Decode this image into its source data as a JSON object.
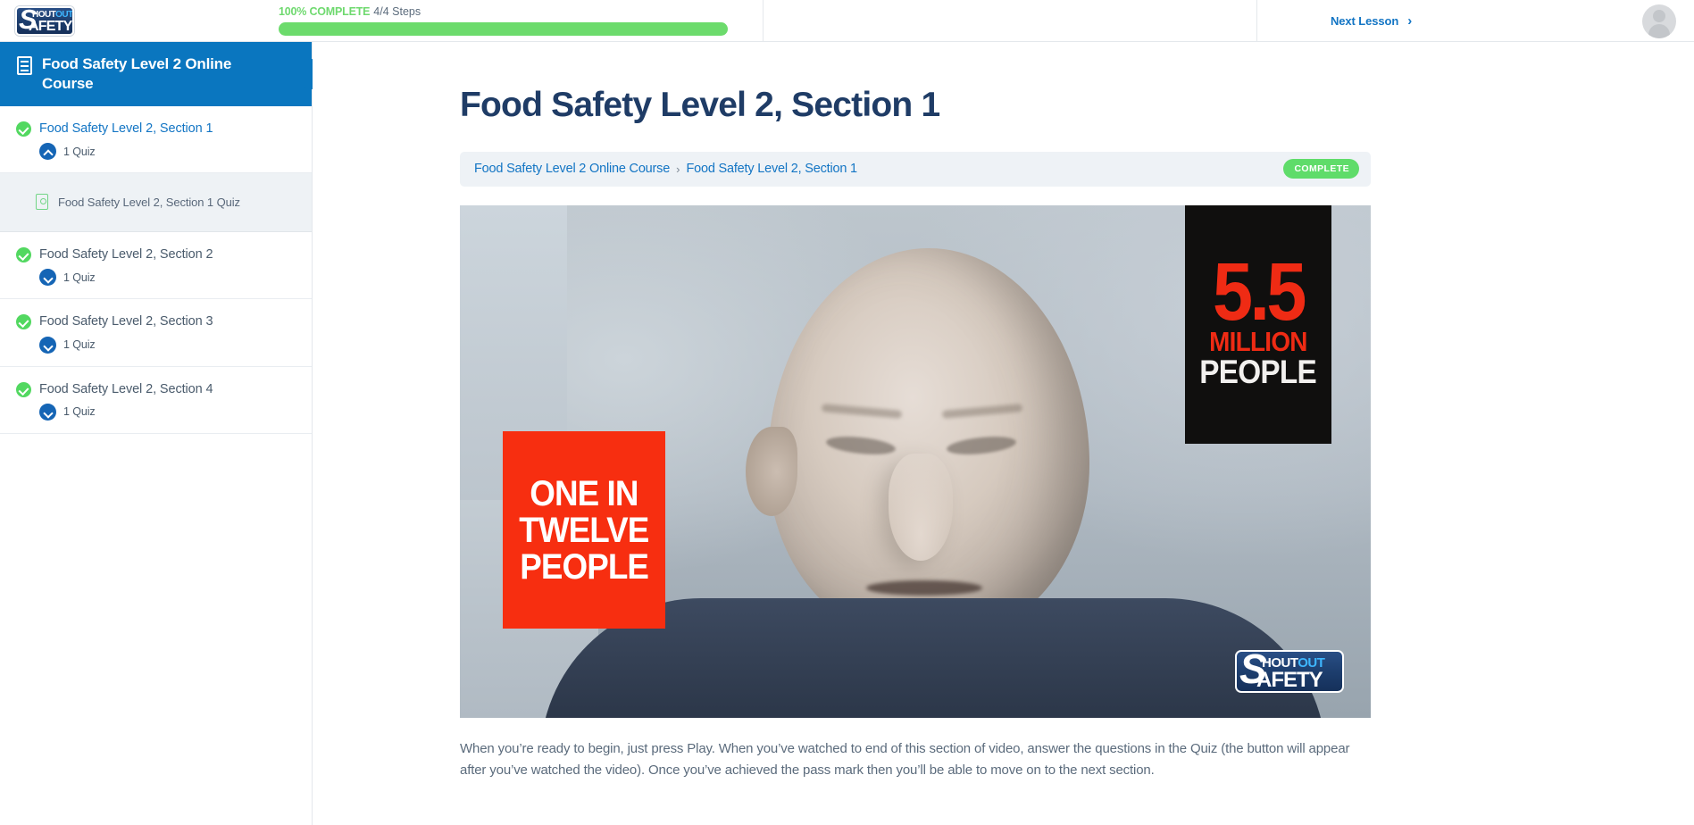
{
  "topbar": {
    "logo": {
      "name": "shout-out-safety-logo",
      "line1_a": "HOUT",
      "line1_b": "OUT",
      "line2": "AFETY",
      "initial": "S"
    },
    "progress": {
      "percent_label": "100% COMPLETE",
      "steps_label": "4/4 Steps",
      "percent_value": 100,
      "fill_color": "#6cdb6c"
    },
    "next_lesson_label": "Next Lesson",
    "next_lesson_icon": "chevron-right-icon",
    "avatar_icon": "user-avatar-placeholder"
  },
  "sidebar": {
    "course_title": "Food Safety Level 2 Online Course",
    "course_icon": "document-list-icon",
    "collapse_icon": "chevron-left-icon",
    "lessons": [
      {
        "name": "Food Safety Level 2, Section 1",
        "status_icon": "check-circle-icon",
        "active": true,
        "quiz_count_label": "1 Quiz",
        "caret_icon": "chevron-up-icon",
        "expanded": true,
        "sub_items": [
          {
            "label": "Food Safety Level 2, Section 1 Quiz",
            "icon": "quiz-icon"
          }
        ]
      },
      {
        "name": "Food Safety Level 2, Section 2",
        "status_icon": "check-circle-icon",
        "active": false,
        "quiz_count_label": "1 Quiz",
        "caret_icon": "chevron-down-icon",
        "expanded": false,
        "sub_items": []
      },
      {
        "name": "Food Safety Level 2, Section 3",
        "status_icon": "check-circle-icon",
        "active": false,
        "quiz_count_label": "1 Quiz",
        "caret_icon": "chevron-down-icon",
        "expanded": false,
        "sub_items": []
      },
      {
        "name": "Food Safety Level 2, Section 4",
        "status_icon": "check-circle-icon",
        "active": false,
        "quiz_count_label": "1 Quiz",
        "caret_icon": "chevron-down-icon",
        "expanded": false,
        "sub_items": []
      }
    ]
  },
  "main": {
    "page_title": "Food Safety Level 2, Section 1",
    "breadcrumb": {
      "items": [
        "Food Safety Level 2 Online Course",
        "Food Safety Level 2, Section 1"
      ],
      "separator": "›"
    },
    "status_badge": "COMPLETE",
    "video": {
      "overlay_red_lines": [
        "ONE IN",
        "TWELVE",
        "PEOPLE"
      ],
      "overlay_black_number": "5.5",
      "overlay_black_million": "MILLION",
      "overlay_black_people": "PEOPLE",
      "watermark_initial": "S",
      "watermark_line1_a": "HOUT",
      "watermark_line1_b": "OUT",
      "watermark_line2": "AFETY"
    },
    "body_text": "When you’re ready to begin, just press Play. When you’ve watched to end of this section of video, answer the questions in the Quiz (the button will appear after you’ve watched the video). Once you’ve achieved the pass mark then you’ll be able to move on to the next section."
  },
  "colors": {
    "brand_blue": "#0a76bf",
    "link_blue": "#1375c4",
    "success_green": "#5fdc6a",
    "title_navy": "#1f3c66",
    "accent_red": "#f72e10"
  }
}
